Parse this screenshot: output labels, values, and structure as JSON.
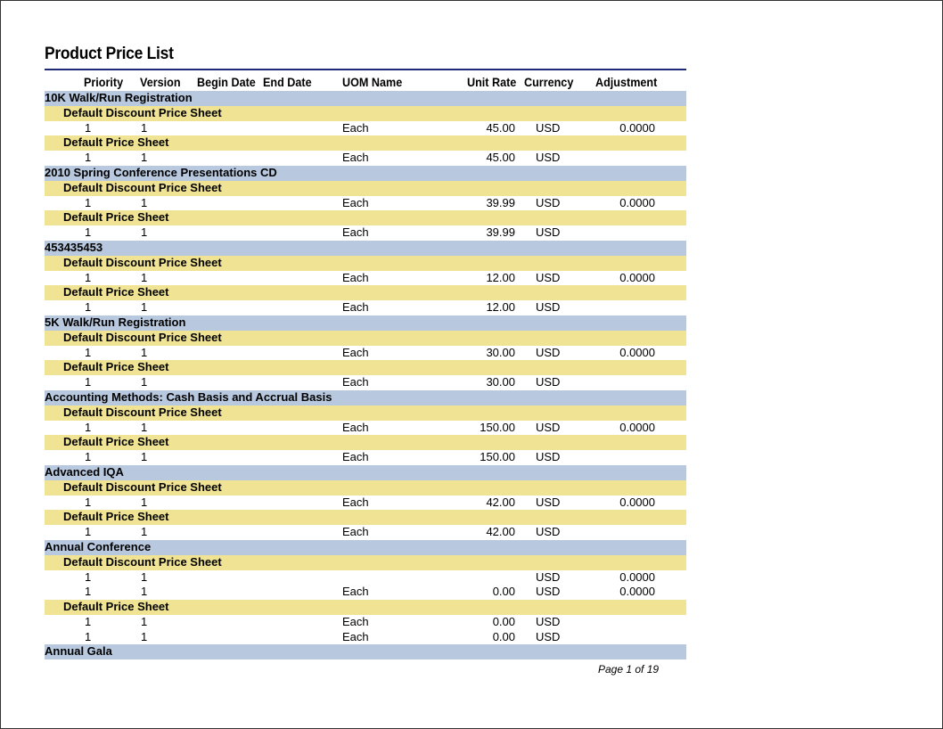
{
  "report": {
    "title": "Product Price List",
    "footer": "Page 1 of 19"
  },
  "columns": {
    "priority": "Priority",
    "version": "Version",
    "begin_date": "Begin Date",
    "end_date": "End Date",
    "uom_name": "UOM Name",
    "unit_rate": "Unit Rate",
    "currency": "Currency",
    "adjustment": "Adjustment"
  },
  "colors": {
    "product_band": "#b8c8de",
    "sheet_band": "#f0e494",
    "rule": "#1f2a7a"
  },
  "rows": [
    {
      "type": "product",
      "label": "10K Walk/Run Registration"
    },
    {
      "type": "sheet",
      "label": "Default Discount Price Sheet"
    },
    {
      "type": "data",
      "priority": "1",
      "version": "1",
      "uom": "Each",
      "rate": "45.00",
      "currency": "USD",
      "adjustment": "0.0000"
    },
    {
      "type": "sheet",
      "label": "Default Price Sheet"
    },
    {
      "type": "data",
      "priority": "1",
      "version": "1",
      "uom": "Each",
      "rate": "45.00",
      "currency": "USD",
      "adjustment": ""
    },
    {
      "type": "product",
      "label": "2010 Spring Conference Presentations CD"
    },
    {
      "type": "sheet",
      "label": "Default Discount Price Sheet"
    },
    {
      "type": "data",
      "priority": "1",
      "version": "1",
      "uom": "Each",
      "rate": "39.99",
      "currency": "USD",
      "adjustment": "0.0000"
    },
    {
      "type": "sheet",
      "label": "Default Price Sheet"
    },
    {
      "type": "data",
      "priority": "1",
      "version": "1",
      "uom": "Each",
      "rate": "39.99",
      "currency": "USD",
      "adjustment": ""
    },
    {
      "type": "product",
      "label": "453435453"
    },
    {
      "type": "sheet",
      "label": "Default Discount Price Sheet"
    },
    {
      "type": "data",
      "priority": "1",
      "version": "1",
      "uom": "Each",
      "rate": "12.00",
      "currency": "USD",
      "adjustment": "0.0000"
    },
    {
      "type": "sheet",
      "label": "Default Price Sheet"
    },
    {
      "type": "data",
      "priority": "1",
      "version": "1",
      "uom": "Each",
      "rate": "12.00",
      "currency": "USD",
      "adjustment": ""
    },
    {
      "type": "product",
      "label": "5K Walk/Run Registration"
    },
    {
      "type": "sheet",
      "label": "Default Discount Price Sheet"
    },
    {
      "type": "data",
      "priority": "1",
      "version": "1",
      "uom": "Each",
      "rate": "30.00",
      "currency": "USD",
      "adjustment": "0.0000"
    },
    {
      "type": "sheet",
      "label": "Default Price Sheet"
    },
    {
      "type": "data",
      "priority": "1",
      "version": "1",
      "uom": "Each",
      "rate": "30.00",
      "currency": "USD",
      "adjustment": ""
    },
    {
      "type": "product",
      "label": "Accounting Methods: Cash Basis and Accrual Basis"
    },
    {
      "type": "sheet",
      "label": "Default Discount Price Sheet"
    },
    {
      "type": "data",
      "priority": "1",
      "version": "1",
      "uom": "Each",
      "rate": "150.00",
      "currency": "USD",
      "adjustment": "0.0000"
    },
    {
      "type": "sheet",
      "label": "Default Price Sheet"
    },
    {
      "type": "data",
      "priority": "1",
      "version": "1",
      "uom": "Each",
      "rate": "150.00",
      "currency": "USD",
      "adjustment": ""
    },
    {
      "type": "product",
      "label": "Advanced IQA"
    },
    {
      "type": "sheet",
      "label": "Default Discount Price Sheet"
    },
    {
      "type": "data",
      "priority": "1",
      "version": "1",
      "uom": "Each",
      "rate": "42.00",
      "currency": "USD",
      "adjustment": "0.0000"
    },
    {
      "type": "sheet",
      "label": "Default Price Sheet"
    },
    {
      "type": "data",
      "priority": "1",
      "version": "1",
      "uom": "Each",
      "rate": "42.00",
      "currency": "USD",
      "adjustment": ""
    },
    {
      "type": "product",
      "label": "Annual Conference"
    },
    {
      "type": "sheet",
      "label": "Default Discount Price Sheet"
    },
    {
      "type": "data",
      "priority": "1",
      "version": "1",
      "uom": "",
      "rate": "",
      "currency": "USD",
      "adjustment": "0.0000"
    },
    {
      "type": "data",
      "priority": "1",
      "version": "1",
      "uom": "Each",
      "rate": "0.00",
      "currency": "USD",
      "adjustment": "0.0000"
    },
    {
      "type": "sheet",
      "label": "Default Price Sheet"
    },
    {
      "type": "data",
      "priority": "1",
      "version": "1",
      "uom": "Each",
      "rate": "0.00",
      "currency": "USD",
      "adjustment": ""
    },
    {
      "type": "data",
      "priority": "1",
      "version": "1",
      "uom": "Each",
      "rate": "0.00",
      "currency": "USD",
      "adjustment": ""
    },
    {
      "type": "product",
      "label": "Annual Gala"
    }
  ]
}
